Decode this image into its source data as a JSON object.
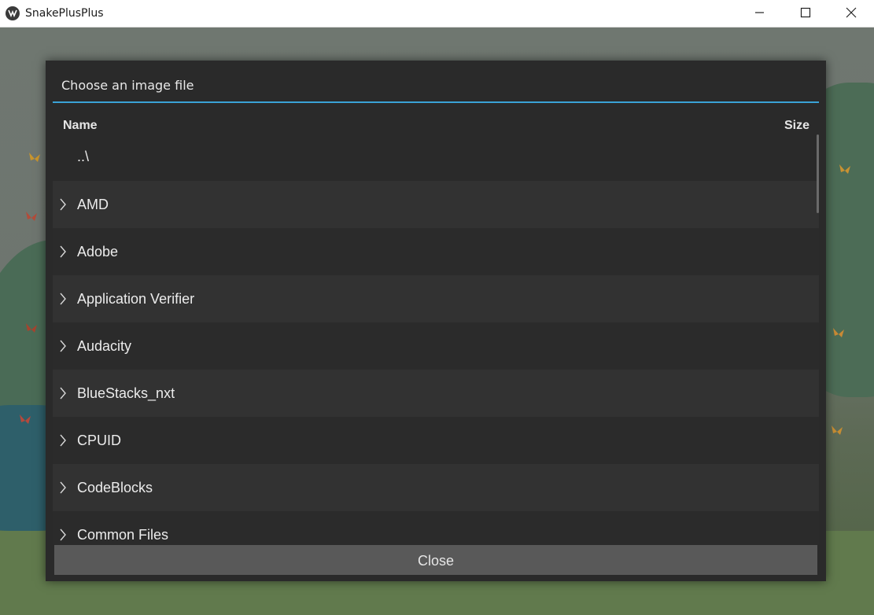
{
  "window": {
    "title": "SnakePlusPlus",
    "controls": [
      "minimize-icon",
      "maximize-icon",
      "close-icon"
    ]
  },
  "dialog": {
    "title": "Choose an image file",
    "accent_color": "#3aa3d7",
    "columns": {
      "name": "Name",
      "size": "Size"
    },
    "parent_entry": "..\\",
    "items": [
      {
        "label": "AMD",
        "icon": "chevron-right-icon"
      },
      {
        "label": "Adobe",
        "icon": "chevron-right-icon"
      },
      {
        "label": "Application Verifier",
        "icon": "chevron-right-icon"
      },
      {
        "label": "Audacity",
        "icon": "chevron-right-icon"
      },
      {
        "label": "BlueStacks_nxt",
        "icon": "chevron-right-icon"
      },
      {
        "label": "CPUID",
        "icon": "chevron-right-icon"
      },
      {
        "label": "CodeBlocks",
        "icon": "chevron-right-icon"
      },
      {
        "label": "Common Files",
        "icon": "chevron-right-icon"
      }
    ],
    "close_label": "Close"
  }
}
